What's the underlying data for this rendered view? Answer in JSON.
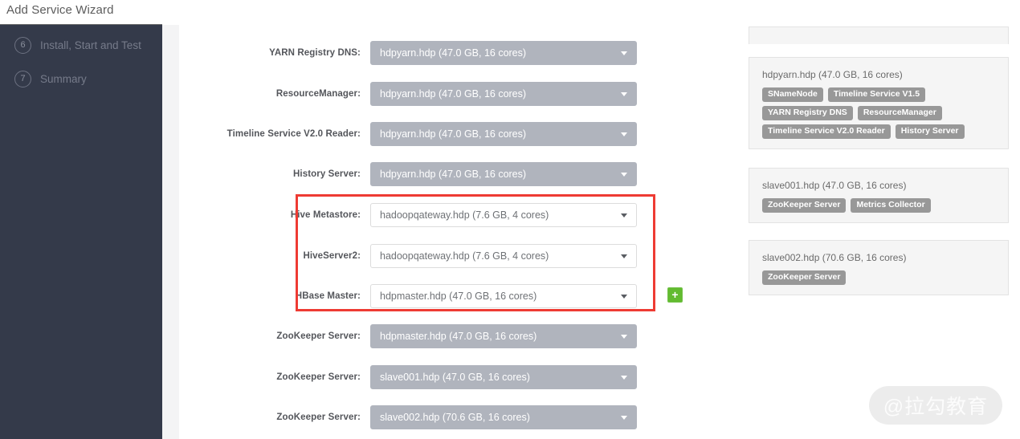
{
  "window": {
    "title": "Add Service Wizard"
  },
  "sidebar": {
    "steps": [
      {
        "number": "6",
        "label": "Install, Start and Test"
      },
      {
        "number": "7",
        "label": "Summary"
      }
    ]
  },
  "assignments": [
    {
      "label": "YARN Registry DNS:",
      "value": "hdpyarn.hdp (47.0 GB, 16 cores)",
      "state": "disabled"
    },
    {
      "label": "ResourceManager:",
      "value": "hdpyarn.hdp (47.0 GB, 16 cores)",
      "state": "disabled"
    },
    {
      "label": "Timeline Service V2.0 Reader:",
      "value": "hdpyarn.hdp (47.0 GB, 16 cores)",
      "state": "disabled"
    },
    {
      "label": "History Server:",
      "value": "hdpyarn.hdp (47.0 GB, 16 cores)",
      "state": "disabled"
    },
    {
      "label": "Hive Metastore:",
      "value": "hadoopqateway.hdp (7.6 GB, 4 cores)",
      "state": "enabled"
    },
    {
      "label": "HiveServer2:",
      "value": "hadoopqateway.hdp (7.6 GB, 4 cores)",
      "state": "enabled"
    },
    {
      "label": "HBase Master:",
      "value": "hdpmaster.hdp (47.0 GB, 16 cores)",
      "state": "enabled"
    },
    {
      "label": "ZooKeeper Server:",
      "value": "hdpmaster.hdp (47.0 GB, 16 cores)",
      "state": "disabled"
    },
    {
      "label": "ZooKeeper Server:",
      "value": "slave001.hdp (47.0 GB, 16 cores)",
      "state": "disabled"
    },
    {
      "label": "ZooKeeper Server:",
      "value": "slave002.hdp (70.6 GB, 16 cores)",
      "state": "disabled"
    }
  ],
  "add_button": {
    "glyph": "+",
    "color": "#62bb30"
  },
  "highlight": {
    "color": "#ee3b33"
  },
  "hosts": [
    {
      "title": "hdpyarn.hdp (47.0 GB, 16 cores)",
      "components": [
        "SNameNode",
        "Timeline Service V1.5",
        "YARN Registry DNS",
        "ResourceManager",
        "Timeline Service V2.0 Reader",
        "History Server"
      ]
    },
    {
      "title": "slave001.hdp (47.0 GB, 16 cores)",
      "components": [
        "ZooKeeper Server",
        "Metrics Collector"
      ]
    },
    {
      "title": "slave002.hdp (70.6 GB, 16 cores)",
      "components": [
        "ZooKeeper Server"
      ]
    }
  ],
  "watermark": {
    "text": "@拉勾教育"
  }
}
